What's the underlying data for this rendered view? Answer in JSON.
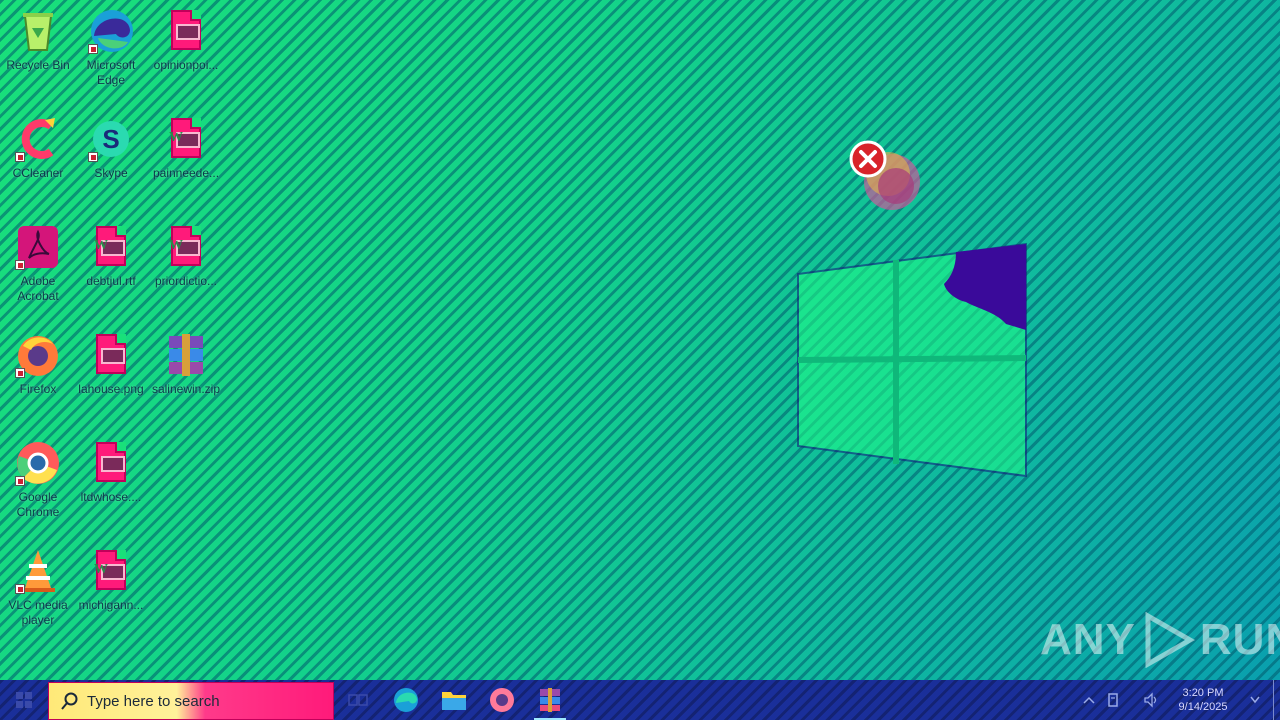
{
  "desktop": {
    "icons": [
      {
        "name": "recycle-bin",
        "label": "Recycle Bin"
      },
      {
        "name": "microsoft-edge",
        "label": "Microsoft Edge"
      },
      {
        "name": "opinionpoi",
        "label": "opinionpoi..."
      },
      {
        "name": "ccleaner",
        "label": "CCleaner"
      },
      {
        "name": "skype",
        "label": "Skype"
      },
      {
        "name": "painneede",
        "label": "painneede..."
      },
      {
        "name": "adobe-acrobat",
        "label": "Adobe Acrobat"
      },
      {
        "name": "debtjul",
        "label": "debtjul.rtf"
      },
      {
        "name": "priordictio",
        "label": "priordictio..."
      },
      {
        "name": "firefox",
        "label": "Firefox"
      },
      {
        "name": "lahouse",
        "label": "lahouse.png"
      },
      {
        "name": "salinewin",
        "label": "salinewin.zip"
      },
      {
        "name": "google-chrome",
        "label": "Google Chrome"
      },
      {
        "name": "ltdwhose",
        "label": "ltdwhose...."
      },
      {
        "name": "vlc",
        "label": "VLC media player"
      },
      {
        "name": "michigann",
        "label": "michigann..."
      }
    ]
  },
  "watermark": {
    "text_left": "ANY",
    "text_right": "RUN"
  },
  "taskbar": {
    "search_placeholder": "Type here to search",
    "apps": [
      "task-view",
      "edge",
      "file-explorer",
      "firefox",
      "winrar"
    ],
    "clock_time": "3:20 PM",
    "clock_date": "9/14/2025"
  },
  "colors": {
    "desktop_bg": "#19e07a",
    "taskbar_bg": "#1a2f9a",
    "search_pink": "#ff1a7a"
  }
}
